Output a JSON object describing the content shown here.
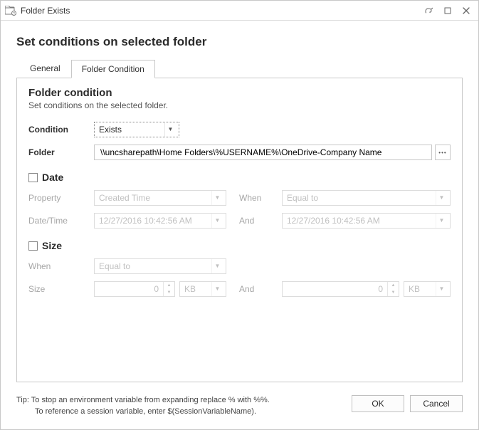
{
  "window": {
    "title": "Folder Exists"
  },
  "page": {
    "heading": "Set conditions on selected folder"
  },
  "tabs": {
    "general": "General",
    "folder_condition": "Folder Condition"
  },
  "panel": {
    "title": "Folder condition",
    "subtitle": "Set conditions on the selected folder."
  },
  "fields": {
    "condition_label": "Condition",
    "condition_value": "Exists",
    "folder_label": "Folder",
    "folder_value": "\\\\uncsharepath\\Home Folders\\%USERNAME%\\OneDrive-Company Name"
  },
  "date_group": {
    "title": "Date",
    "property_label": "Property",
    "property_value": "Created Time",
    "when_label": "When",
    "when_value": "Equal to",
    "datetime_label": "Date/Time",
    "datetime_value": "12/27/2016 10:42:56 AM",
    "and_label": "And",
    "and_value": "12/27/2016 10:42:56 AM"
  },
  "size_group": {
    "title": "Size",
    "when_label": "When",
    "when_value": "Equal to",
    "size_label": "Size",
    "size_value": "0",
    "size_unit": "KB",
    "and_label": "And",
    "and_value": "0",
    "and_unit": "KB"
  },
  "footer": {
    "tip_line1": "Tip: To stop an environment variable from expanding replace % with %%.",
    "tip_line2": "To reference a session variable, enter $(SessionVariableName).",
    "ok": "OK",
    "cancel": "Cancel"
  }
}
